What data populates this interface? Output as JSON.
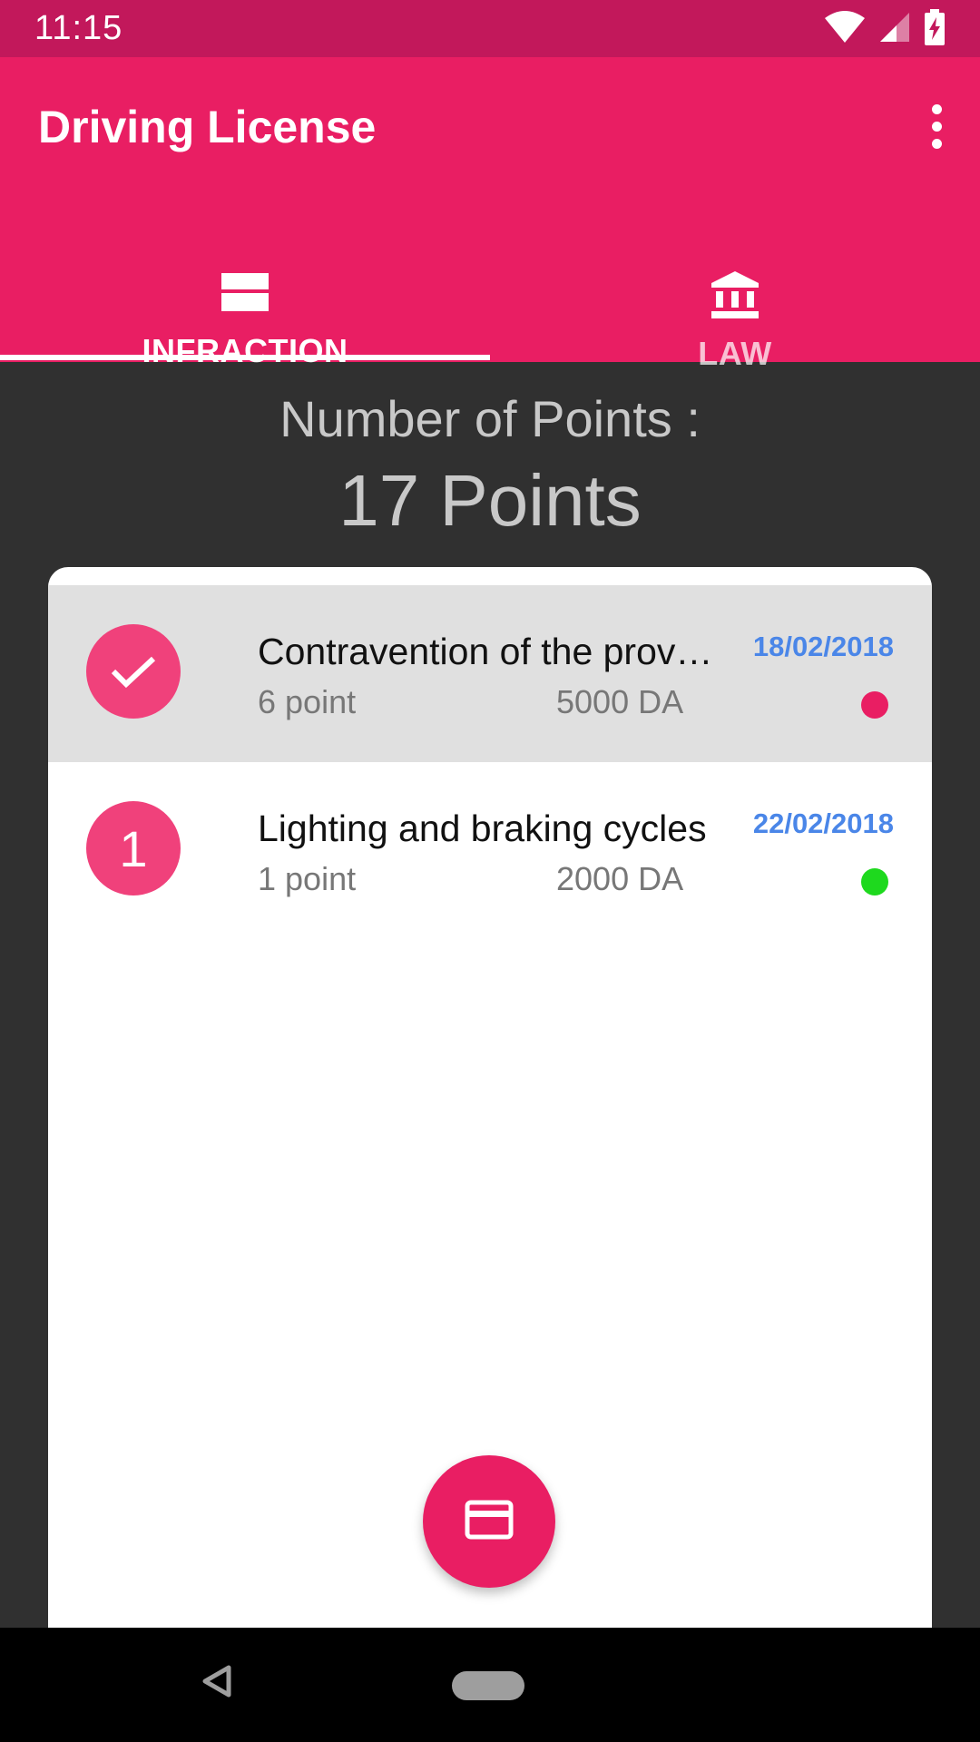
{
  "status_bar": {
    "time": "11:15",
    "icons": [
      "wifi-icon",
      "cell-signal-icon",
      "battery-charging-icon"
    ]
  },
  "app_bar": {
    "title": "Driving License",
    "overflow_icon": "more-vert-icon",
    "background": "#e91e63",
    "status_background": "#c2185b"
  },
  "tabs": [
    {
      "label": "INFRACTION",
      "icon": "view-stream-icon",
      "selected": true
    },
    {
      "label": "LAW",
      "icon": "bank-icon",
      "selected": false
    }
  ],
  "summary": {
    "label": "Number of Points :",
    "value": "17 Points"
  },
  "infractions": [
    {
      "avatar": "check-icon",
      "avatar_text": "",
      "title": "Contravention of the provisions",
      "points": "6 point",
      "amount": "5000 DA",
      "date": "18/02/2018",
      "status_color": "#e91e63",
      "selected": true
    },
    {
      "avatar": "number",
      "avatar_text": "1",
      "title": "Lighting and braking cycles",
      "points": "1 point",
      "amount": "2000 DA",
      "date": "22/02/2018",
      "status_color": "#1ed91e",
      "selected": false
    }
  ],
  "fab": {
    "icon": "credit-card-icon"
  },
  "nav_bar": {
    "back_icon": "back-triangle-icon",
    "home_icon": "home-pill-icon"
  }
}
